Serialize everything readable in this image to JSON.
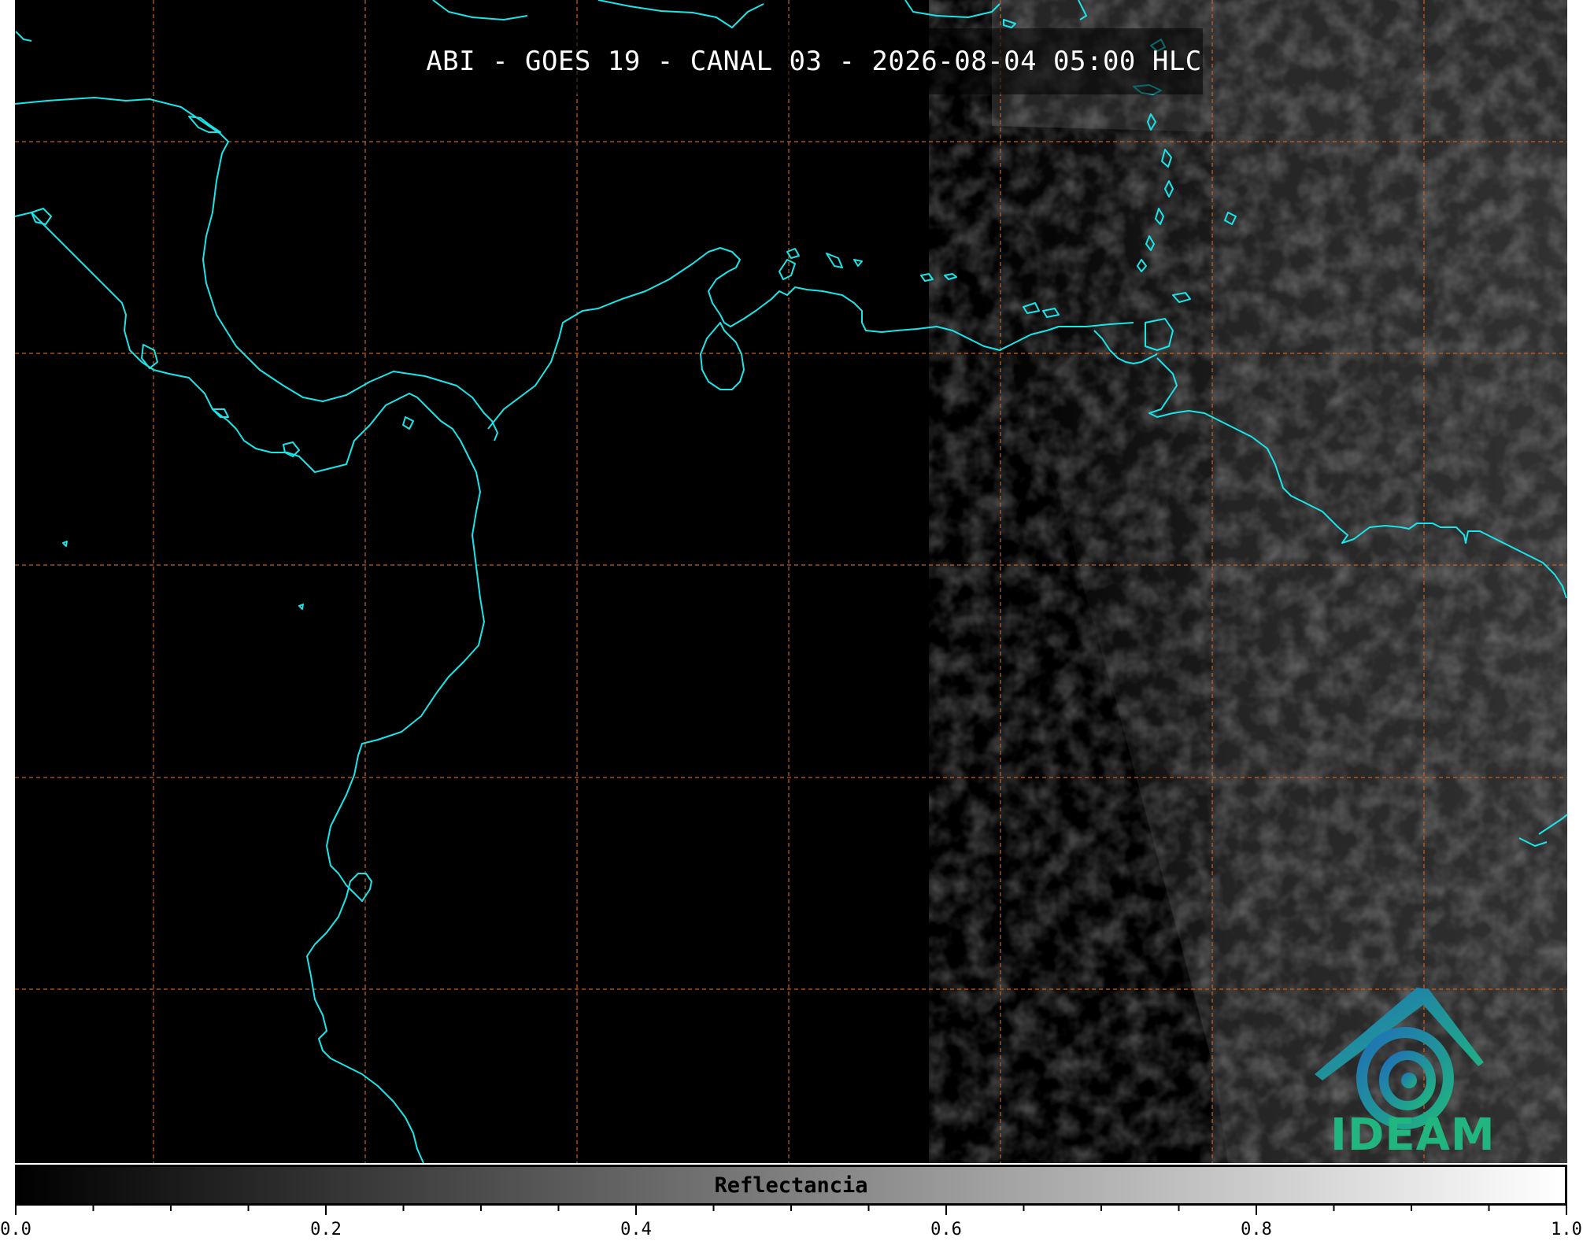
{
  "map": {
    "title": "ABI - GOES 19 - CANAL 03 - 2026-08-04 05:00 HLC",
    "coastline_color": "#19e6ea",
    "graticule_color": "#c8621e",
    "background_color": "#000000"
  },
  "colorbar": {
    "label": "Reflectancia",
    "range": [
      0.0,
      1.0
    ],
    "major_ticks": [
      "0.0",
      "0.2",
      "0.4",
      "0.6",
      "0.8",
      "1.0"
    ],
    "major_tick_values": [
      0.0,
      0.2,
      0.4,
      0.6,
      0.8,
      1.0
    ],
    "minor_tick_values": [
      0.05,
      0.1,
      0.15,
      0.25,
      0.3,
      0.35,
      0.45,
      0.5,
      0.55,
      0.65,
      0.7,
      0.75,
      0.85,
      0.9,
      0.95
    ],
    "gradient": [
      "#000000",
      "#ffffff"
    ]
  },
  "logo": {
    "text": "IDEAM",
    "icon": "ideam-logo-icon",
    "colors": [
      "#1f6fb8",
      "#21b57f"
    ]
  }
}
